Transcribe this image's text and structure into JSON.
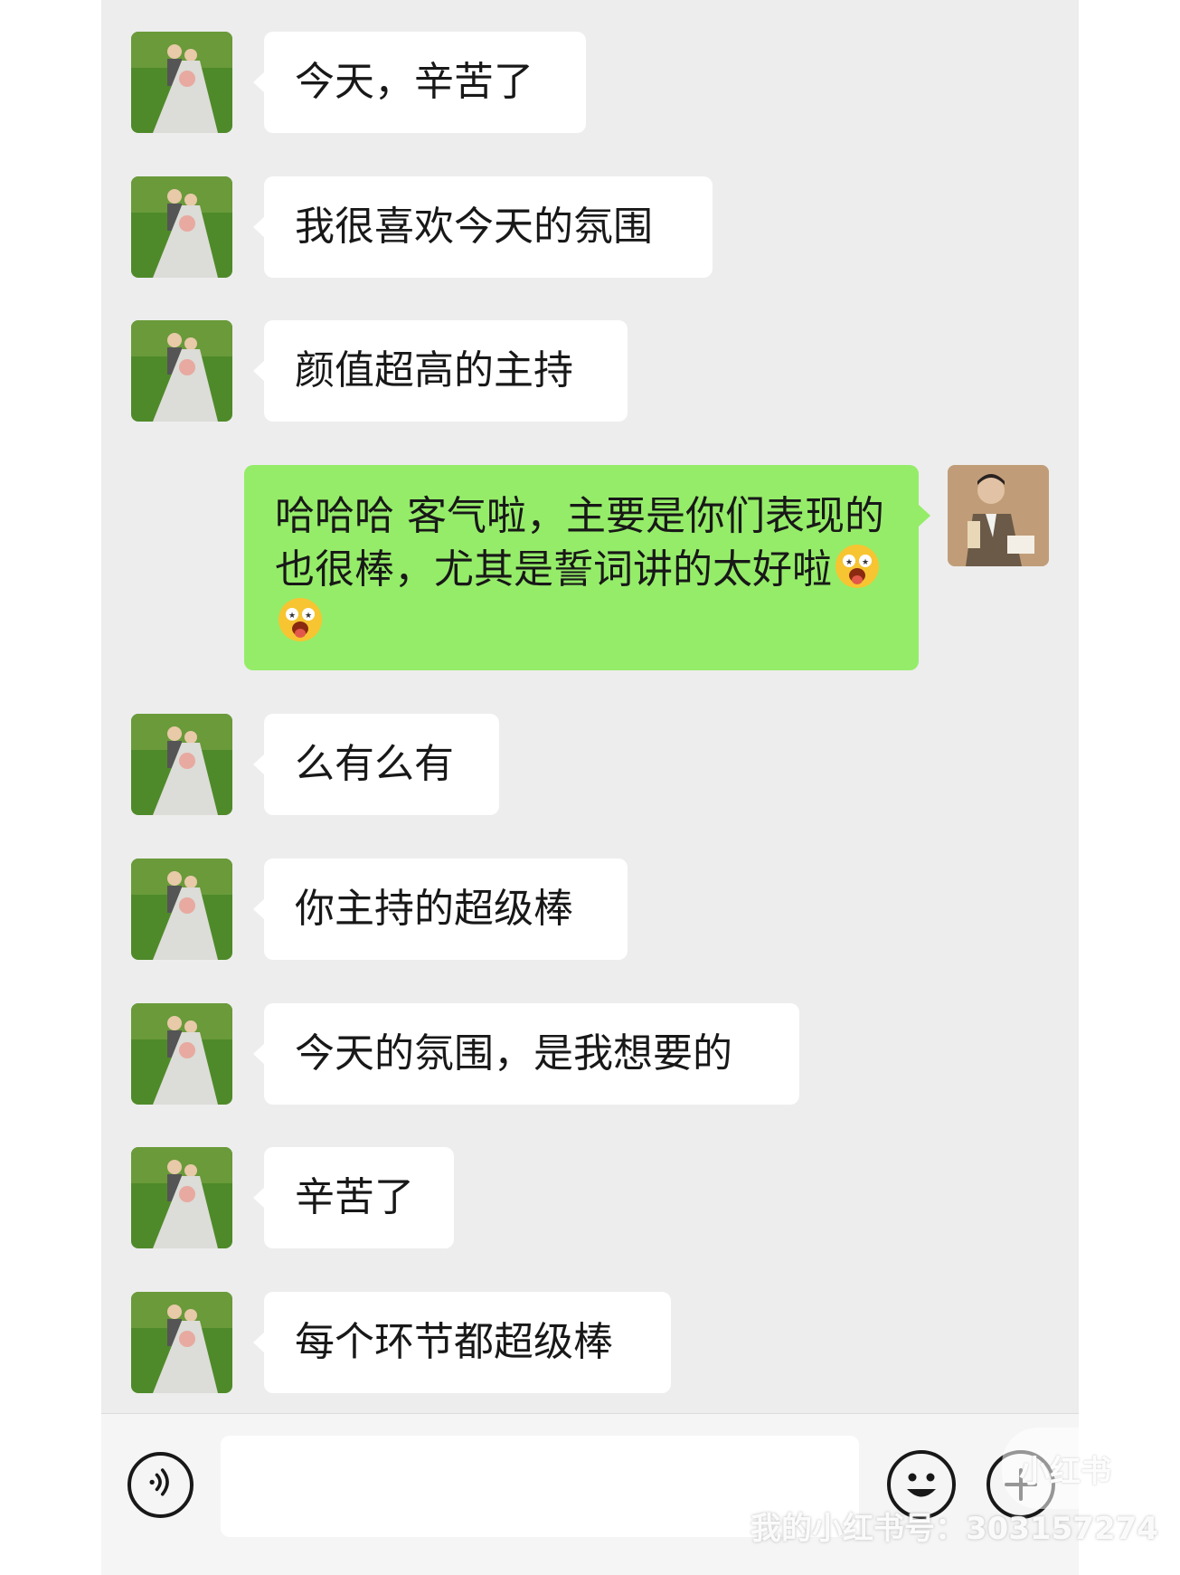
{
  "messages": [
    {
      "side": "left",
      "text": "今天，辛苦了",
      "avatar": "bride-groom-avatar"
    },
    {
      "side": "left",
      "text": "我很喜欢今天的氛围",
      "avatar": "bride-groom-avatar"
    },
    {
      "side": "left",
      "text": "颜值超高的主持",
      "avatar": "bride-groom-avatar"
    },
    {
      "side": "right",
      "text": "哈哈哈 客气啦，主要是你们表现的也很棒，尤其是誓词讲的太好啦",
      "emojis": [
        "drooling-star-eyes-emoji",
        "drooling-star-eyes-emoji"
      ],
      "avatar": "host-avatar"
    },
    {
      "side": "left",
      "text": "么有么有",
      "avatar": "bride-groom-avatar"
    },
    {
      "side": "left",
      "text": "你主持的超级棒",
      "avatar": "bride-groom-avatar"
    },
    {
      "side": "left",
      "text": "今天的氛围，是我想要的",
      "avatar": "bride-groom-avatar"
    },
    {
      "side": "left",
      "text": "辛苦了",
      "avatar": "bride-groom-avatar"
    },
    {
      "side": "left",
      "text": "每个环节都超级棒",
      "avatar": "bride-groom-avatar"
    }
  ],
  "input_bar": {
    "voice_icon": "voice-icon",
    "emoji_icon": "smiley-icon",
    "plus_icon": "plus-icon",
    "text_value": ""
  },
  "watermark": {
    "logo": "小红书",
    "id_text": "我的小红书号：303157274"
  },
  "colors": {
    "background": "#ededed",
    "incoming_bubble": "#ffffff",
    "outgoing_bubble": "#95ec69",
    "text": "#181818"
  }
}
